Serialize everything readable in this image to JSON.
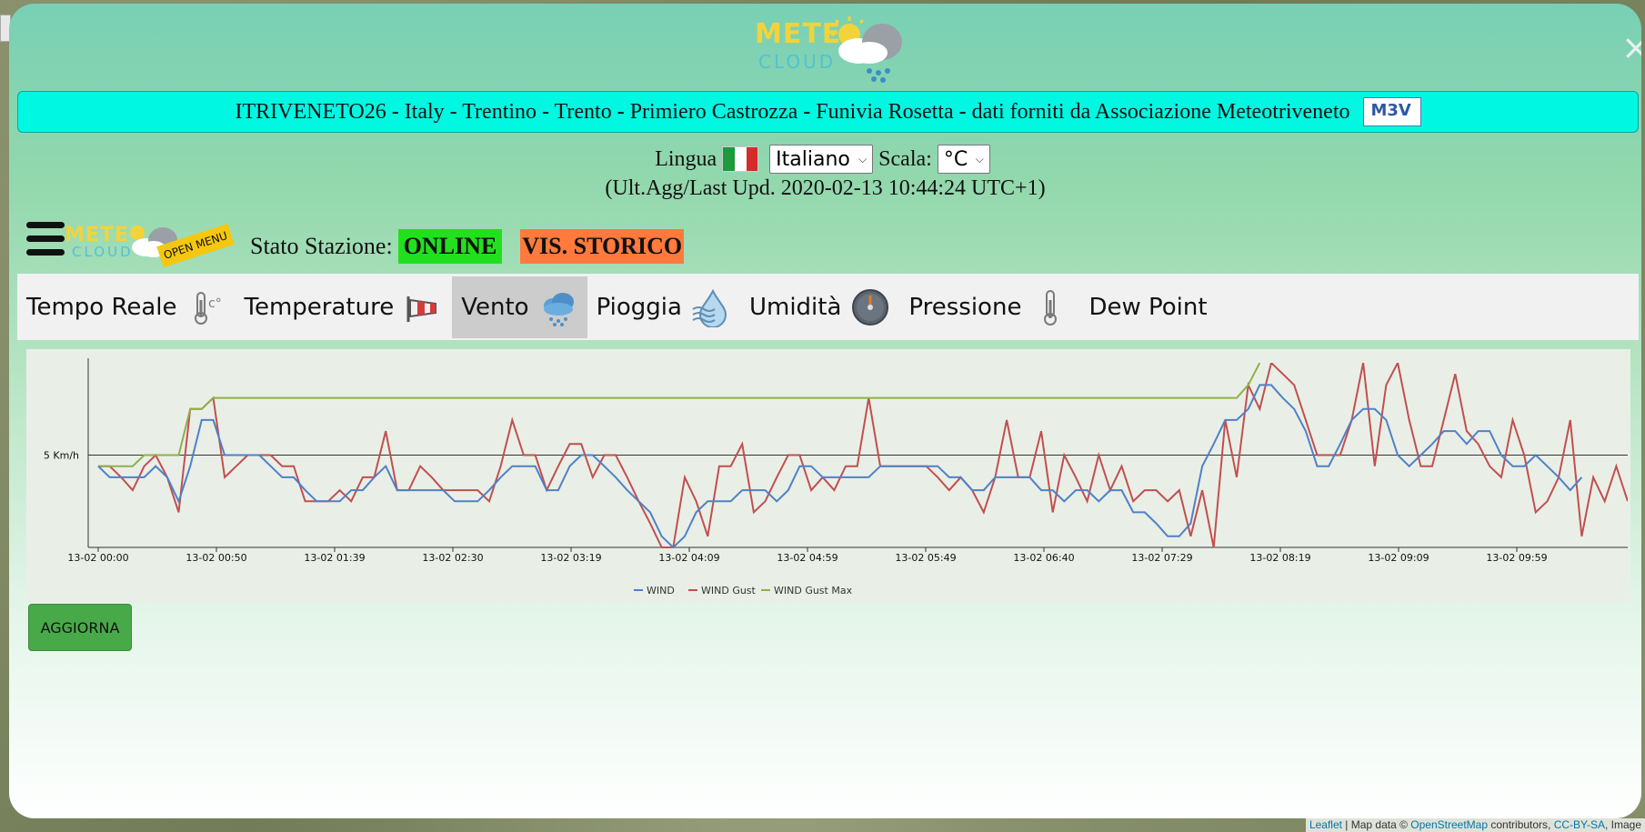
{
  "logo": {
    "meteo": "METE",
    "cloud": "CLOUD"
  },
  "station": {
    "title": "ITRIVENETO26 - Italy - Trentino - Trento - Primiero Castrozza - Funivia Rosetta - dati forniti da Associazione Meteotriveneto",
    "badge": "M3V"
  },
  "language": {
    "label": "Lingua",
    "selected": "Italiano",
    "scale_label": "Scala:",
    "scale_selected": "°C",
    "last_update": "(Ult.Agg/Last Upd. 2020-02-13 10:44:24  UTC+1)"
  },
  "menu": {
    "open_label": "OPEN MENU"
  },
  "status": {
    "label": "Stato Stazione:",
    "online": "ONLINE",
    "storico": "VIS. STORICO",
    "online_color": "#22e01e",
    "storico_color": "#ff7a3c"
  },
  "tabs": [
    {
      "label": "Tempo Reale",
      "icon": "thermometer-celsius-icon",
      "active": false
    },
    {
      "label": "Temperature",
      "icon": "windsock-icon",
      "active": false
    },
    {
      "label": "Vento",
      "icon": "rain-cloud-icon",
      "active": true
    },
    {
      "label": "Pioggia",
      "icon": "humidity-drop-icon",
      "active": false
    },
    {
      "label": "Umidità",
      "icon": "barometer-icon",
      "active": false
    },
    {
      "label": "Pressione",
      "icon": "thermometer-icon",
      "active": false
    },
    {
      "label": "Dew Point",
      "icon": "",
      "active": false
    }
  ],
  "refresh_button": "AGGIORNA",
  "close_icon": "×",
  "attribution": {
    "leaflet": "Leaflet",
    "text1": " | Map data © ",
    "osm": "OpenStreetMap",
    "text2": " contributors, ",
    "cc": "CC-BY-SA",
    "text3": ", Image"
  },
  "colors": {
    "wind": "#4f81c7",
    "gust": "#c24f4f",
    "gust_max": "#8fb04a",
    "station_bar": "#00f7e2"
  },
  "chart_data": {
    "type": "line",
    "ylabel_ref": "5 Km/h",
    "ref_value": 5,
    "ylim": [
      0,
      10
    ],
    "x_tick_labels": [
      "13-02 00:00",
      "13-02 00:50",
      "13-02 01:39",
      "13-02 02:30",
      "13-02 03:19",
      "13-02 04:09",
      "13-02 04:59",
      "13-02 05:49",
      "13-02 06:40",
      "13-02 07:29",
      "13-02 08:19",
      "13-02 09:09",
      "13-02 09:59"
    ],
    "legend": [
      "WIND",
      "WIND Gust",
      "WIND Gust Max"
    ],
    "legend_position": "bottom-center",
    "series": [
      {
        "name": "WIND",
        "values": [
          4.4,
          3.8,
          3.8,
          3.8,
          3.8,
          4.4,
          3.8,
          2.5,
          4.4,
          6.9,
          6.9,
          5.0,
          5.0,
          5.0,
          5.0,
          4.4,
          3.8,
          3.8,
          3.1,
          2.5,
          2.5,
          2.5,
          3.1,
          3.1,
          3.8,
          4.4,
          3.1,
          3.1,
          3.1,
          3.1,
          3.1,
          2.5,
          2.5,
          2.5,
          3.1,
          3.8,
          4.4,
          4.4,
          4.4,
          3.1,
          3.1,
          4.4,
          5.0,
          5.0,
          4.4,
          3.8,
          3.1,
          2.5,
          1.9,
          0.6,
          0.0,
          0.6,
          1.9,
          2.5,
          2.5,
          2.5,
          3.1,
          3.1,
          3.1,
          2.5,
          3.1,
          4.4,
          4.4,
          3.8,
          3.8,
          3.8,
          3.8,
          3.8,
          4.4,
          4.4,
          4.4,
          4.4,
          4.4,
          4.4,
          3.8,
          3.8,
          3.1,
          3.1,
          3.8,
          3.8,
          3.8,
          3.8,
          3.1,
          3.1,
          2.5,
          3.1,
          3.1,
          2.5,
          3.1,
          3.1,
          1.9,
          1.9,
          1.3,
          0.6,
          0.6,
          1.3,
          4.4,
          5.6,
          6.9,
          6.9,
          7.5,
          8.8,
          8.8,
          8.1,
          7.5,
          6.3,
          4.4,
          4.4,
          5.6,
          6.9,
          7.5,
          7.5,
          6.9,
          5.0,
          4.4,
          5.0,
          5.6,
          6.3,
          6.3,
          5.6,
          6.3,
          6.3,
          5.0,
          4.4,
          4.4,
          5.0,
          4.4,
          3.8,
          3.1,
          3.8
        ]
      },
      {
        "name": "WIND Gust",
        "values": [
          4.4,
          4.4,
          3.8,
          3.1,
          4.4,
          5.0,
          3.8,
          1.9,
          7.5,
          7.5,
          8.1,
          3.8,
          4.4,
          5.0,
          5.0,
          5.0,
          4.4,
          4.4,
          2.5,
          2.5,
          2.5,
          3.1,
          2.5,
          3.8,
          3.8,
          6.3,
          3.1,
          3.1,
          4.4,
          3.8,
          3.1,
          3.1,
          3.1,
          3.1,
          2.5,
          4.4,
          6.9,
          5.0,
          5.0,
          3.1,
          4.4,
          5.6,
          5.6,
          3.8,
          5.0,
          5.0,
          3.8,
          2.5,
          1.3,
          0.0,
          0.0,
          3.8,
          2.5,
          0.6,
          4.4,
          4.4,
          5.6,
          1.9,
          2.5,
          3.8,
          5.0,
          5.0,
          3.1,
          3.8,
          3.1,
          4.4,
          4.4,
          8.1,
          4.4,
          4.4,
          4.4,
          4.4,
          4.4,
          3.8,
          3.1,
          3.8,
          3.1,
          1.9,
          3.8,
          6.9,
          3.8,
          3.8,
          6.3,
          1.9,
          5.0,
          3.8,
          2.5,
          5.0,
          3.1,
          4.4,
          2.5,
          3.1,
          3.1,
          2.5,
          3.1,
          0.6,
          3.1,
          0.0,
          6.9,
          3.8,
          8.8,
          7.5,
          10.0,
          9.4,
          8.8,
          6.9,
          5.0,
          5.0,
          5.0,
          6.9,
          10.0,
          4.4,
          8.8,
          10.0,
          6.9,
          4.4,
          4.4,
          6.9,
          9.4,
          6.3,
          5.6,
          4.4,
          3.8,
          6.9,
          5.0,
          1.9,
          2.5,
          3.8,
          6.9,
          0.6,
          3.8,
          2.5,
          4.4,
          2.5
        ]
      },
      {
        "name": "WIND Gust Max",
        "values": [
          4.4,
          4.4,
          4.4,
          4.4,
          5.0,
          5.0,
          5.0,
          5.0,
          7.5,
          7.5,
          8.1,
          8.1,
          8.1,
          8.1,
          8.1,
          8.1,
          8.1,
          8.1,
          8.1,
          8.1,
          8.1,
          8.1,
          8.1,
          8.1,
          8.1,
          8.1,
          8.1,
          8.1,
          8.1,
          8.1,
          8.1,
          8.1,
          8.1,
          8.1,
          8.1,
          8.1,
          8.1,
          8.1,
          8.1,
          8.1,
          8.1,
          8.1,
          8.1,
          8.1,
          8.1,
          8.1,
          8.1,
          8.1,
          8.1,
          8.1,
          8.1,
          8.1,
          8.1,
          8.1,
          8.1,
          8.1,
          8.1,
          8.1,
          8.1,
          8.1,
          8.1,
          8.1,
          8.1,
          8.1,
          8.1,
          8.1,
          8.1,
          8.1,
          8.1,
          8.1,
          8.1,
          8.1,
          8.1,
          8.1,
          8.1,
          8.1,
          8.1,
          8.1,
          8.1,
          8.1,
          8.1,
          8.1,
          8.1,
          8.1,
          8.1,
          8.1,
          8.1,
          8.1,
          8.1,
          8.1,
          8.1,
          8.1,
          8.1,
          8.1,
          8.1,
          8.1,
          8.1,
          8.1,
          8.1,
          8.1,
          8.8,
          10.0
        ]
      }
    ]
  }
}
